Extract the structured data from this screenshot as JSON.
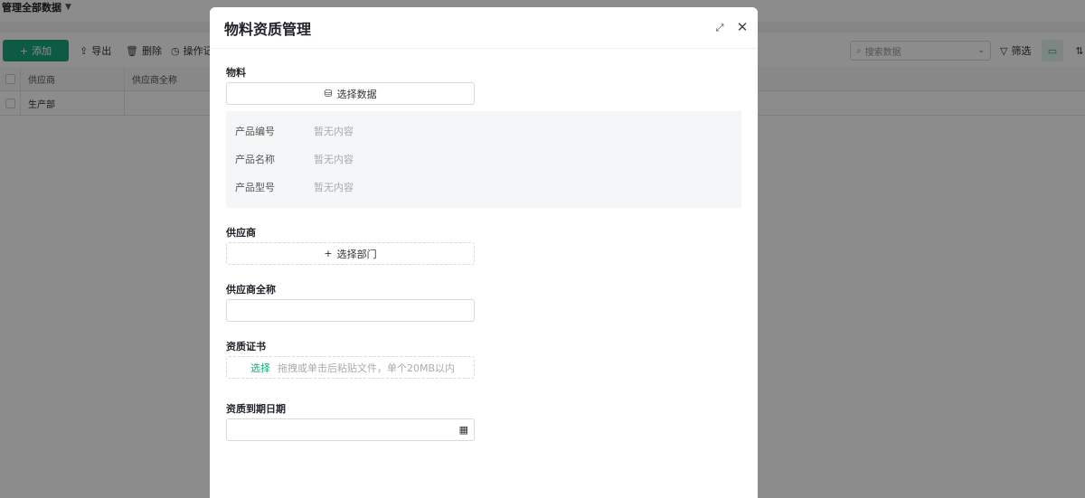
{
  "background": {
    "view_title": "管理全部数据",
    "toolbar": {
      "add_label": "添加",
      "export_label": "导出",
      "delete_label": "删除",
      "operation_label": "操作记",
      "search_placeholder": "搜索数据",
      "filter_label": "筛选"
    },
    "table": {
      "columns": [
        "供应商",
        "供应商全称"
      ],
      "rows": [
        [
          "生产部",
          ""
        ]
      ]
    }
  },
  "modal": {
    "title": "物料资质管理",
    "material": {
      "label": "物料",
      "select_button": "选择数据",
      "info": [
        {
          "key": "产品编号",
          "value": "暂无内容"
        },
        {
          "key": "产品名称",
          "value": "暂无内容"
        },
        {
          "key": "产品型号",
          "value": "暂无内容"
        }
      ]
    },
    "supplier": {
      "label": "供应商",
      "select_button": "选择部门"
    },
    "supplier_full_name": {
      "label": "供应商全称",
      "value": ""
    },
    "certificate": {
      "label": "资质证书",
      "select_link": "选择",
      "hint": "拖拽或单击后粘贴文件，单个20MB以内"
    },
    "expiry_date": {
      "label": "资质到期日期",
      "value": ""
    }
  },
  "colors": {
    "accent": "#17a779",
    "overlay": "rgba(0,0,0,0.45)"
  }
}
